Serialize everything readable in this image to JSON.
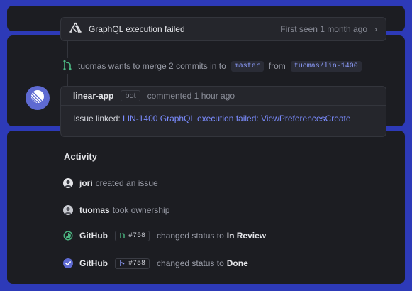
{
  "sentry": {
    "title": "GraphQL execution failed",
    "meta": "First seen 1 month ago",
    "chevron": "›",
    "icon": "sentry-icon"
  },
  "merge": {
    "text": "tuomas wants to merge 2 commits in to",
    "target_branch": "master",
    "from_label": "from",
    "source_branch": "tuomas/lin-1400",
    "icon": "git-merge-icon"
  },
  "comment": {
    "author": "linear-app",
    "bot_badge": "bot",
    "when": "commented 1 hour ago",
    "body_prefix": "Issue linked:",
    "link_text": "LIN-1400 GraphQL execution failed: ViewPreferencesCreate",
    "avatar_icon": "linear-logo-icon"
  },
  "activity": {
    "title": "Activity",
    "items": [
      {
        "who": "jori",
        "rest": "created an issue"
      },
      {
        "who": "tuomas",
        "rest": "took ownership"
      },
      {
        "who": "GitHub",
        "pr": "#758",
        "rest": "changed status to",
        "status": "In Review",
        "status_color": "#4cb782"
      },
      {
        "who": "GitHub",
        "pr": "#758",
        "rest": "changed status to",
        "status": "Done",
        "status_color": "#5e6ad2"
      }
    ]
  },
  "colors": {
    "background": "#2d3ab8",
    "panel": "#1c1d22",
    "accent": "#5e6ad2",
    "link": "#7b8cff",
    "merge_green": "#4cb782"
  }
}
